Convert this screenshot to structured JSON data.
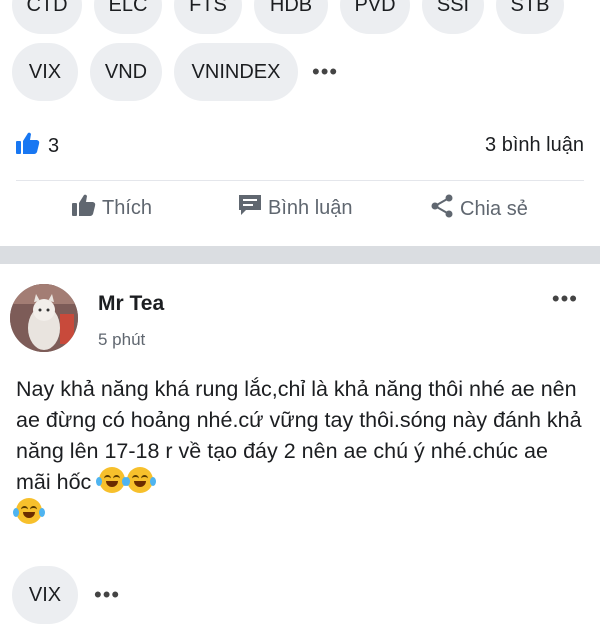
{
  "tags_row1": [
    "CTD",
    "ELC",
    "FTS",
    "HDB",
    "PVD",
    "SSI",
    "STB"
  ],
  "tags_row2": [
    "VIX",
    "VND",
    "VNINDEX"
  ],
  "more_symbol": "•••",
  "stats": {
    "likes": "3",
    "comments": "3 bình luận"
  },
  "actions": {
    "like": "Thích",
    "comment": "Bình luận",
    "share": "Chia sẻ"
  },
  "post": {
    "author": "Mr Tea",
    "time": "5 phút",
    "body": "Nay khả năng khá rung lắc,chỉ là khả năng thôi nhé ae nên ae đừng có hoảng nhé.cứ vững tay thôi.sóng này đánh khả năng lên 17-18 r về tạo đáy 2 nên ae chú ý nhé.chúc ae mãi hốc",
    "emoji": "joy-emoji"
  },
  "bottom_tags": [
    "VIX"
  ],
  "colors": {
    "accent": "#1877f2",
    "chip_bg": "#eceef1",
    "separator": "#dadde1"
  }
}
